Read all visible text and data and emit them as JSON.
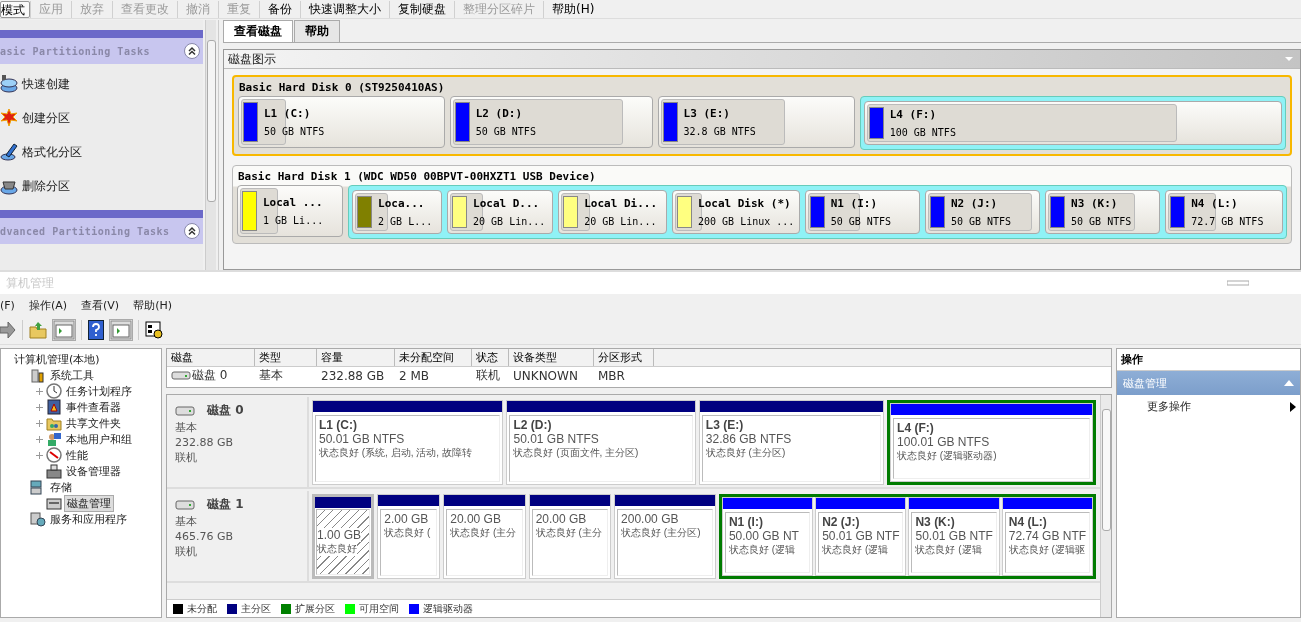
{
  "partition_tool": {
    "toolbar": [
      {
        "label": "模式",
        "disabled": false,
        "pressed": true
      },
      {
        "label": "应用",
        "disabled": true,
        "pressed": false
      },
      {
        "label": "放弃",
        "disabled": true,
        "pressed": false
      },
      {
        "label": "查看更改",
        "disabled": true,
        "pressed": false
      },
      {
        "label": "撤消",
        "disabled": true,
        "pressed": false
      },
      {
        "label": "重复",
        "disabled": true,
        "pressed": false
      },
      {
        "label": "备份",
        "disabled": false,
        "pressed": false
      },
      {
        "label": "快速调整大小",
        "disabled": false,
        "pressed": false
      },
      {
        "label": "复制硬盘",
        "disabled": false,
        "pressed": false
      },
      {
        "label": "整理分区碎片",
        "disabled": true,
        "pressed": false
      },
      {
        "label": "帮助(H)",
        "disabled": false,
        "pressed": false
      }
    ],
    "task_sections": [
      {
        "title": "asic Partitioning Tasks",
        "expanded": true,
        "items": [
          "快速创建",
          "创建分区",
          "格式化分区",
          "删除分区"
        ]
      },
      {
        "title": "dvanced Partitioning Tasks",
        "expanded": true
      }
    ],
    "tabs": [
      {
        "label": "查看磁盘",
        "selected": true
      },
      {
        "label": "帮助",
        "selected": false
      }
    ],
    "panel_title": "磁盘图示",
    "disks": [
      {
        "title": "Basic Hard Disk 0 (ST9250410AS)",
        "selected": true,
        "partitions": [
          {
            "kind": "partition",
            "name": "L1 (C:)",
            "size": "50 GB NTFS",
            "color": "#0000ff",
            "level": 0.21
          },
          {
            "kind": "partition",
            "name": "L2 (D:)",
            "size": "50 GB NTFS",
            "color": "#0000ff",
            "level": 0.84
          },
          {
            "kind": "partition",
            "name": "L3 (E:)",
            "size": "32.8 GB NTFS",
            "color": "#0000ff",
            "level": 0.63
          },
          {
            "kind": "extended",
            "partitions": [
              {
                "kind": "partition",
                "name": "L4 (F:)",
                "size": "100 GB NTFS",
                "color": "#0000ff",
                "level": 0.74
              }
            ]
          }
        ]
      },
      {
        "title": "Basic Hard Disk 1 (WDC WD50 00BPVT-00HXZT1 USB Device)",
        "selected": false,
        "partitions": [
          {
            "kind": "partition",
            "name": "Local ...",
            "size": "1 GB Li...",
            "color": "#ffff00",
            "level": 0.35
          },
          {
            "kind": "extended",
            "partitions": [
              {
                "kind": "partition",
                "name": "Loca...",
                "size": "2 GB L...",
                "color": "#808000",
                "level": 0.35
              },
              {
                "kind": "partition",
                "name": "Local D...",
                "size": "20 GB Lin...",
                "color": "#ffff80",
                "level": 0.3
              },
              {
                "kind": "partition",
                "name": "Local Di...",
                "size": "20 GB Lin...",
                "color": "#ffff80",
                "level": 0.25
              },
              {
                "kind": "partition",
                "name": "Local Disk (*)",
                "size": "200 GB Linux ...",
                "color": "#ffff80",
                "level": 0.2
              },
              {
                "kind": "partition",
                "name": "N1 (I:)",
                "size": "50 GB NTFS",
                "color": "#0000ff",
                "level": 0.44
              },
              {
                "kind": "partition",
                "name": "N2 (J:)",
                "size": "50 GB NTFS",
                "color": "#0000ff",
                "level": 0.9
              },
              {
                "kind": "partition",
                "name": "N3 (K:)",
                "size": "50 GB NTFS",
                "color": "#0000ff",
                "level": 0.75
              },
              {
                "kind": "partition",
                "name": "N4 (L:)",
                "size": "72.7 GB NTFS",
                "color": "#0000ff",
                "level": 0.4
              }
            ]
          }
        ]
      }
    ]
  },
  "management": {
    "title": "算机管理",
    "menu": [
      "(F)",
      "操作(A)",
      "查看(V)",
      "帮助(H)"
    ],
    "tree": [
      {
        "label": "计算机管理(本地)",
        "selected": false,
        "children": [
          {
            "label": "系统工具",
            "selected": false,
            "children": [
              {
                "label": "任务计划程序",
                "selected": false,
                "expanded": false
              },
              {
                "label": "事件查看器",
                "selected": false,
                "expanded": false
              },
              {
                "label": "共享文件夹",
                "selected": false,
                "expanded": false
              },
              {
                "label": "本地用户和组",
                "selected": false,
                "expanded": false
              },
              {
                "label": "性能",
                "selected": false,
                "expanded": false
              },
              {
                "label": "设备管理器",
                "selected": false
              }
            ]
          },
          {
            "label": "存储",
            "selected": false,
            "children": [
              {
                "label": "磁盘管理",
                "selected": true
              }
            ]
          },
          {
            "label": "服务和应用程序",
            "selected": false
          }
        ]
      }
    ],
    "table": {
      "columns": [
        "磁盘",
        "类型",
        "容量",
        "未分配空间",
        "状态",
        "设备类型",
        "分区形式"
      ],
      "rows": [
        [
          "磁盘 0",
          "基本",
          "232.88 GB",
          "2 MB",
          "联机",
          "UNKNOWN",
          "MBR"
        ]
      ]
    },
    "disks": [
      {
        "name": "磁盘 0",
        "type": "基本",
        "size": "232.88 GB",
        "status": "联机",
        "partitions": [
          {
            "kind": "primary",
            "name": "L1 (C:)",
            "size": "50.01 GB NTFS",
            "status": "状态良好 (系统, 启动, 活动, 故障转",
            "selected": false
          },
          {
            "kind": "primary",
            "name": "L2 (D:)",
            "size": "50.01 GB NTFS",
            "status": "状态良好 (页面文件, 主分区)",
            "selected": false
          },
          {
            "kind": "primary",
            "name": "L3 (E:)",
            "size": "32.86 GB NTFS",
            "status": "状态良好 (主分区)",
            "selected": false
          },
          {
            "kind": "extended",
            "partitions": [
              {
                "kind": "logical",
                "name": "L4 (F:)",
                "size": "100.01 GB NTFS",
                "status": "状态良好 (逻辑驱动器)",
                "selected": false
              }
            ]
          }
        ]
      },
      {
        "name": "磁盘 1",
        "type": "基本",
        "size": "465.76 GB",
        "status": "联机",
        "partitions": [
          {
            "kind": "primary",
            "size": "1.00 GB",
            "status": "状态良好",
            "selected": true
          },
          {
            "kind": "primary",
            "size": "2.00 GB",
            "status": "状态良好 (",
            "selected": false
          },
          {
            "kind": "primary",
            "size": "20.00 GB",
            "status": "状态良好 (主分",
            "selected": false
          },
          {
            "kind": "primary",
            "size": "20.00 GB",
            "status": "状态良好 (主分",
            "selected": false
          },
          {
            "kind": "primary",
            "size": "200.00 GB",
            "status": "状态良好 (主分区)",
            "selected": false
          },
          {
            "kind": "extended",
            "partitions": [
              {
                "kind": "logical",
                "name": "N1 (I:)",
                "size": "50.00 GB NT",
                "status": "状态良好 (逻辑",
                "selected": false
              },
              {
                "kind": "logical",
                "name": "N2 (J:)",
                "size": "50.01 GB NTF",
                "status": "状态良好 (逻辑",
                "selected": false
              },
              {
                "kind": "logical",
                "name": "N3 (K:)",
                "size": "50.01 GB NTF",
                "status": "状态良好 (逻辑",
                "selected": false
              },
              {
                "kind": "logical",
                "name": "N4 (L:)",
                "size": "72.74 GB NTF",
                "status": "状态良好 (逻辑驱",
                "selected": false
              }
            ]
          }
        ]
      }
    ],
    "legend": [
      {
        "label": "未分配",
        "color": "#000000"
      },
      {
        "label": "主分区",
        "color": "#000080"
      },
      {
        "label": "扩展分区",
        "color": "#008000"
      },
      {
        "label": "可用空间",
        "color": "#00ff00"
      },
      {
        "label": "逻辑驱动器",
        "color": "#0000ff"
      }
    ],
    "actions": {
      "title": "操作",
      "section": "磁盘管理",
      "items": [
        "更多操作"
      ]
    }
  }
}
